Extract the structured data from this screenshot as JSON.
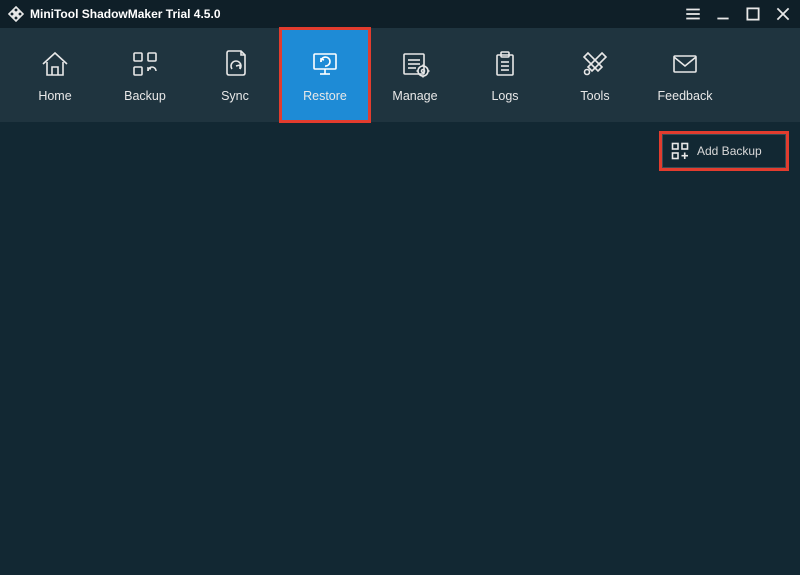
{
  "app": {
    "title": "MiniTool ShadowMaker Trial 4.5.0"
  },
  "nav": {
    "items": [
      {
        "label": "Home"
      },
      {
        "label": "Backup"
      },
      {
        "label": "Sync"
      },
      {
        "label": "Restore"
      },
      {
        "label": "Manage"
      },
      {
        "label": "Logs"
      },
      {
        "label": "Tools"
      },
      {
        "label": "Feedback"
      }
    ],
    "active_index": 3
  },
  "actions": {
    "add_backup_label": "Add Backup"
  },
  "highlight": {
    "nav_index": 3,
    "add_backup": true,
    "color": "#e23c2e"
  }
}
